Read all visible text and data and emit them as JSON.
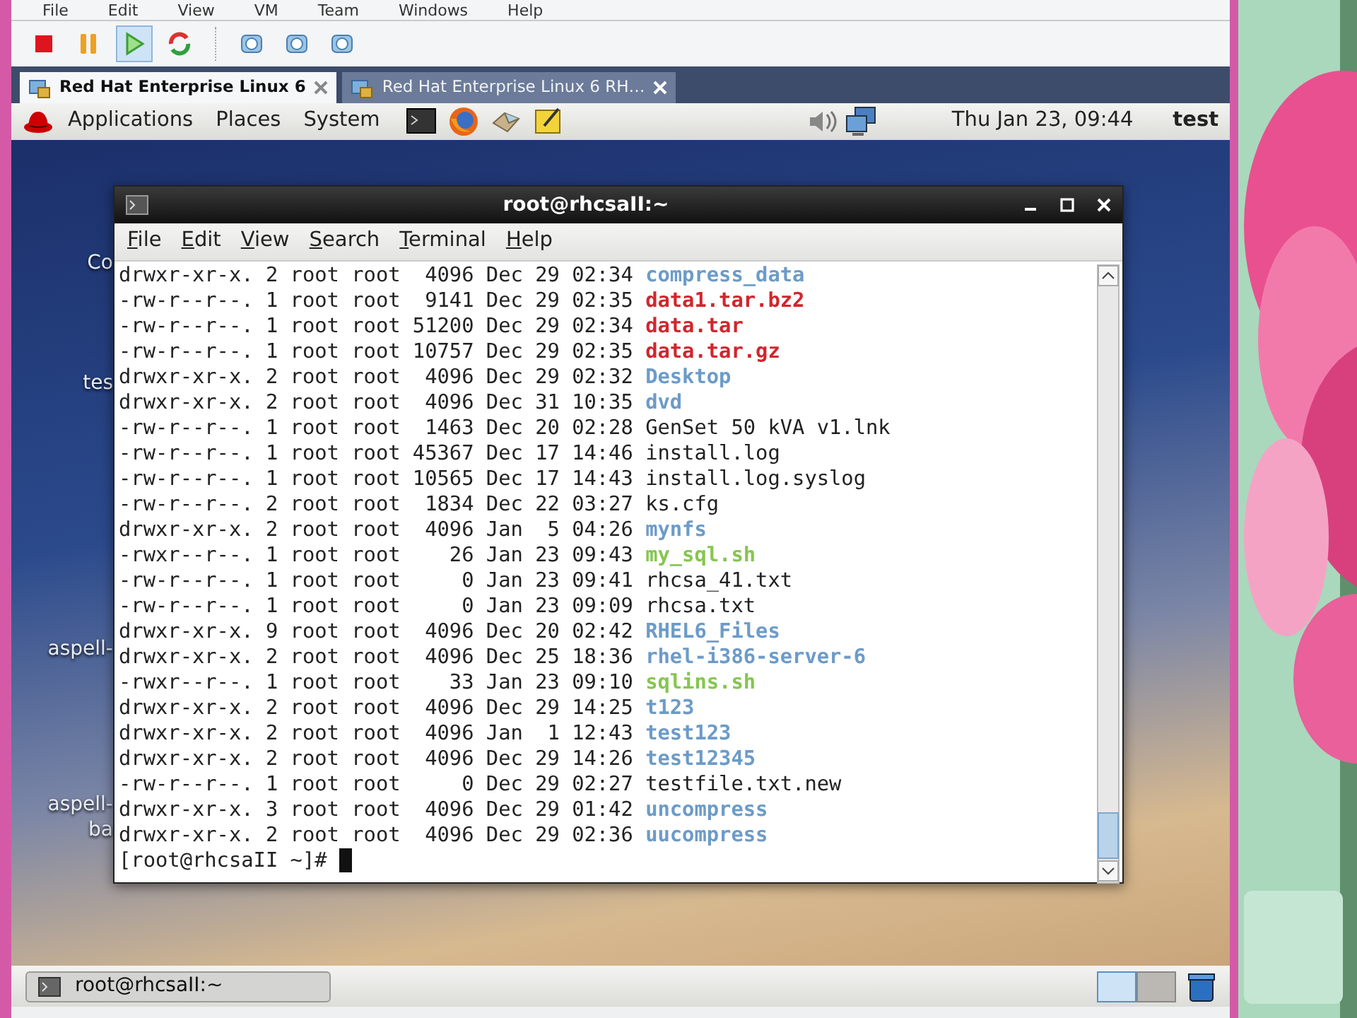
{
  "host_menu": [
    "File",
    "Edit",
    "View",
    "VM",
    "Team",
    "Windows",
    "Help"
  ],
  "toolbar": [
    {
      "kind": "stop",
      "selected": false
    },
    {
      "kind": "pause",
      "selected": false
    },
    {
      "kind": "play",
      "selected": true
    },
    {
      "kind": "reset",
      "selected": false
    },
    {
      "kind": "snapshot",
      "selected": false
    },
    {
      "kind": "snapshot",
      "selected": false
    },
    {
      "kind": "snapshot",
      "selected": false
    }
  ],
  "vm_tabs": [
    {
      "label": "Red Hat Enterprise Linux 6",
      "selected": true
    },
    {
      "label": "Red Hat Enterprise Linux 6 RH…",
      "selected": false
    }
  ],
  "guest_panel": {
    "menus": [
      "Applications",
      "Places",
      "System"
    ],
    "launchers": [
      {
        "kind": "terminal"
      },
      {
        "kind": "browser"
      },
      {
        "kind": "mail"
      },
      {
        "kind": "notes"
      }
    ],
    "clock": "Thu Jan 23, 09:44",
    "user": "test"
  },
  "desktop_labels": [
    {
      "label": "Co"
    },
    {
      "label": "tes"
    },
    {
      "label": "aspell-"
    },
    {
      "label": "aspell-"
    },
    {
      "label": "ba"
    }
  ],
  "terminal": {
    "title": "root@rhcsaII:~",
    "menu": [
      "File",
      "Edit",
      "View",
      "Search",
      "Terminal",
      "Help"
    ],
    "lines": [
      {
        "info": "drwxr-xr-x. 2 root root  4096 Dec 29 02:34",
        "name": "compress_data",
        "kind": "directory"
      },
      {
        "info": "-rw-r--r--. 1 root root  9141 Dec 29 02:35",
        "name": "data1.tar.bz2",
        "kind": "archive"
      },
      {
        "info": "-rw-r--r--. 1 root root 51200 Dec 29 02:34",
        "name": "data.tar",
        "kind": "archive"
      },
      {
        "info": "-rw-r--r--. 1 root root 10757 Dec 29 02:35",
        "name": "data.tar.gz",
        "kind": "archive"
      },
      {
        "info": "drwxr-xr-x. 2 root root  4096 Dec 29 02:32",
        "name": "Desktop",
        "kind": "directory"
      },
      {
        "info": "drwxr-xr-x. 2 root root  4096 Dec 31 10:35",
        "name": "dvd",
        "kind": "directory"
      },
      {
        "info": "-rw-r--r--. 1 root root  1463 Dec 20 02:28",
        "name": "GenSet 50 kVA v1.lnk",
        "kind": "file"
      },
      {
        "info": "-rw-r--r--. 1 root root 45367 Dec 17 14:46",
        "name": "install.log",
        "kind": "file"
      },
      {
        "info": "-rw-r--r--. 1 root root 10565 Dec 17 14:43",
        "name": "install.log.syslog",
        "kind": "file"
      },
      {
        "info": "-rw-r--r--. 2 root root  1834 Dec 22 03:27",
        "name": "ks.cfg",
        "kind": "file"
      },
      {
        "info": "drwxr-xr-x. 2 root root  4096 Jan  5 04:26",
        "name": "mynfs",
        "kind": "directory"
      },
      {
        "info": "-rwxr--r--. 1 root root    26 Jan 23 09:43",
        "name": "my_sql.sh",
        "kind": "executable"
      },
      {
        "info": "-rw-r--r--. 1 root root     0 Jan 23 09:41",
        "name": "rhcsa_41.txt",
        "kind": "file"
      },
      {
        "info": "-rw-r--r--. 1 root root     0 Jan 23 09:09",
        "name": "rhcsa.txt",
        "kind": "file"
      },
      {
        "info": "drwxr-xr-x. 9 root root  4096 Dec 20 02:42",
        "name": "RHEL6_Files",
        "kind": "directory"
      },
      {
        "info": "drwxr-xr-x. 2 root root  4096 Dec 25 18:36",
        "name": "rhel-i386-server-6",
        "kind": "directory"
      },
      {
        "info": "-rwxr--r--. 1 root root    33 Jan 23 09:10",
        "name": "sqlins.sh",
        "kind": "executable"
      },
      {
        "info": "drwxr-xr-x. 2 root root  4096 Dec 29 14:25",
        "name": "t123",
        "kind": "directory"
      },
      {
        "info": "drwxr-xr-x. 2 root root  4096 Jan  1 12:43",
        "name": "test123",
        "kind": "directory"
      },
      {
        "info": "drwxr-xr-x. 2 root root  4096 Dec 29 14:26",
        "name": "test12345",
        "kind": "directory"
      },
      {
        "info": "-rw-r--r--. 1 root root     0 Dec 29 02:27",
        "name": "testfile.txt.new",
        "kind": "file"
      },
      {
        "info": "drwxr-xr-x. 3 root root  4096 Dec 29 01:42",
        "name": "uncompress",
        "kind": "directory"
      },
      {
        "info": "drwxr-xr-x. 2 root root  4096 Dec 29 02:36",
        "name": "uucompress",
        "kind": "directory"
      }
    ],
    "prompt": "[root@rhcsaII ~]#"
  },
  "taskbar": {
    "window_button": "root@rhcsaII:~",
    "workspaces": [
      {
        "selected": true
      },
      {
        "selected": false
      }
    ]
  }
}
